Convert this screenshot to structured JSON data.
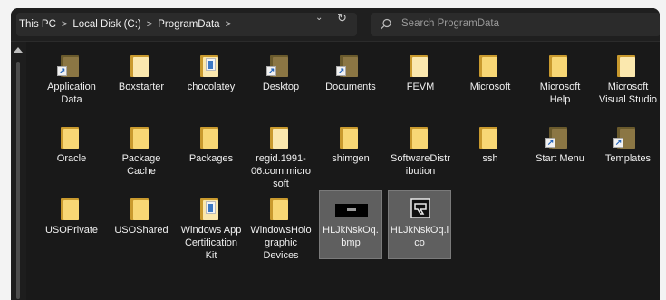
{
  "breadcrumb": {
    "items": [
      "This PC",
      "Local Disk (C:)",
      "ProgramData"
    ],
    "separator": ">"
  },
  "search": {
    "placeholder": "Search ProgramData"
  },
  "items": [
    {
      "label": "Application Data",
      "icon": "folder-shortcut-icon"
    },
    {
      "label": "Boxstarter",
      "icon": "folder-pale-icon"
    },
    {
      "label": "chocolatey",
      "icon": "folder-document-icon"
    },
    {
      "label": "Desktop",
      "icon": "folder-shortcut-icon"
    },
    {
      "label": "Documents",
      "icon": "folder-shortcut-icon"
    },
    {
      "label": "FEVM",
      "icon": "folder-pale-icon"
    },
    {
      "label": "Microsoft",
      "icon": "folder-icon"
    },
    {
      "label": "Microsoft Help",
      "icon": "folder-icon"
    },
    {
      "label": "Microsoft Visual Studio",
      "icon": "folder-pale-icon"
    },
    {
      "label": "Oracle",
      "icon": "folder-icon"
    },
    {
      "label": "Package Cache",
      "icon": "folder-icon"
    },
    {
      "label": "Packages",
      "icon": "folder-icon"
    },
    {
      "label": "regid.1991-06.com.microsoft",
      "icon": "folder-pale-icon"
    },
    {
      "label": "shimgen",
      "icon": "folder-icon"
    },
    {
      "label": "SoftwareDistribution",
      "icon": "folder-icon"
    },
    {
      "label": "ssh",
      "icon": "folder-icon"
    },
    {
      "label": "Start Menu",
      "icon": "folder-shortcut-icon"
    },
    {
      "label": "Templates",
      "icon": "folder-shortcut-icon"
    },
    {
      "label": "USOPrivate",
      "icon": "folder-icon"
    },
    {
      "label": "USOShared",
      "icon": "folder-icon"
    },
    {
      "label": "Windows App Certification Kit",
      "icon": "folder-document-icon"
    },
    {
      "label": "WindowsHolographic Devices",
      "icon": "folder-icon"
    },
    {
      "label": "HLJkNskOq.bmp",
      "icon": "bitmap-file-icon",
      "selected": true
    },
    {
      "label": "HLJkNskOq.ico",
      "icon": "icon-file-icon",
      "selected": true
    }
  ]
}
